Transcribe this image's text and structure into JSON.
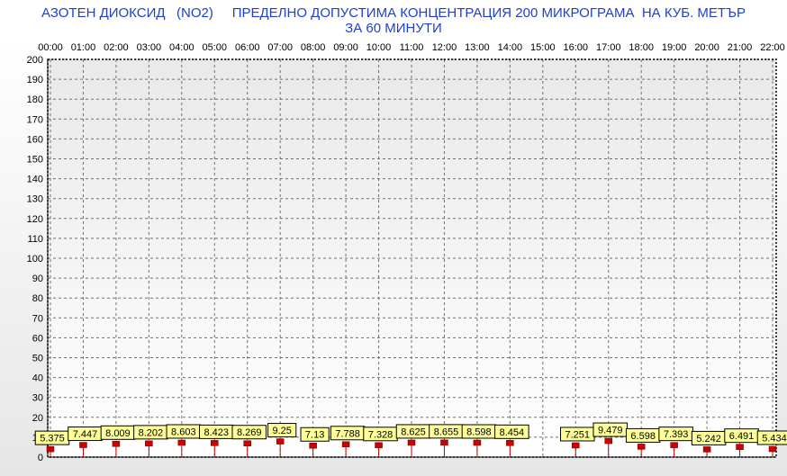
{
  "chart_data": {
    "type": "bar",
    "title": "АЗОТЕН ДИОКСИД   (NO2)     ПРЕДЕЛНО ДОПУСТИМА КОНЦЕНТРАЦИЯ 200 МИКРОГРАМА  НА КУБ. МЕТЪР",
    "subtitle": "ЗА 60 МИНУТИ",
    "xlabel": "",
    "ylabel": "",
    "ylim": [
      0,
      200
    ],
    "y_ticks": [
      0,
      10,
      20,
      30,
      40,
      50,
      60,
      70,
      80,
      90,
      100,
      110,
      120,
      130,
      140,
      150,
      160,
      170,
      180,
      190,
      200
    ],
    "x_axis_position": "top",
    "grid": true,
    "categories": [
      "00:00",
      "01:00",
      "02:00",
      "03:00",
      "04:00",
      "05:00",
      "06:00",
      "07:00",
      "08:00",
      "09:00",
      "10:00",
      "11:00",
      "12:00",
      "13:00",
      "14:00",
      "15:00",
      "16:00",
      "17:00",
      "18:00",
      "19:00",
      "20:00",
      "21:00",
      "22:00"
    ],
    "values": [
      5.375,
      7.447,
      8.009,
      8.202,
      8.603,
      8.423,
      8.269,
      9.25,
      7.13,
      7.788,
      7.328,
      8.625,
      8.655,
      8.598,
      8.454,
      null,
      7.251,
      9.479,
      6.598,
      7.393,
      5.242,
      6.491,
      5.434
    ],
    "data_labels": [
      "5.375",
      "7.447",
      "8.009",
      "8.202",
      "8.603",
      "8.423",
      "8.269",
      "9.25",
      "7.13",
      "7.788",
      "7.328",
      "8.625",
      "8.655",
      "8.598",
      "8.454",
      "",
      "7.251",
      "9.479",
      "6.598",
      "7.393",
      "5.242",
      "6.491",
      "5.434"
    ],
    "colors": {
      "title": "#1f3fd0",
      "marker": "#cc0000",
      "label_fill": "#ffff99",
      "grid": "#707070",
      "limit_line": "#cc0000"
    }
  }
}
